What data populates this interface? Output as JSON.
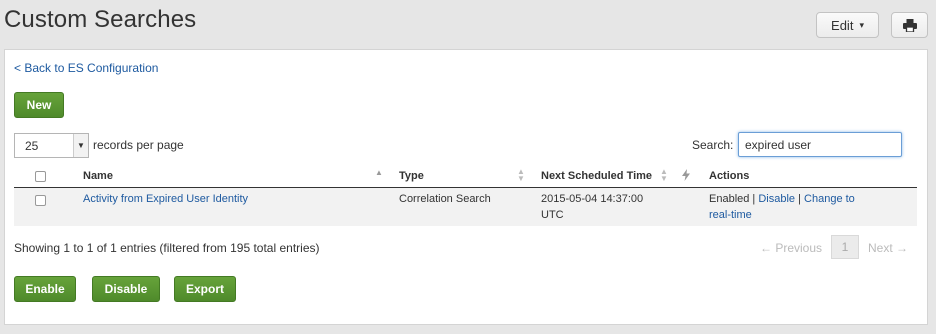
{
  "header": {
    "title": "Custom Searches",
    "edit_label": "Edit",
    "edit_caret": "▾"
  },
  "nav": {
    "back_label": "< Back to ES Configuration"
  },
  "toolbar": {
    "new_label": "New",
    "page_size": "25",
    "records_per_page_label": "records per page",
    "search_label": "Search:",
    "search_value": "expired user"
  },
  "table": {
    "columns": [
      "Name",
      "Type",
      "Next Scheduled Time",
      "Actions"
    ],
    "rows": [
      {
        "name": "Activity from Expired User Identity",
        "type": "Correlation Search",
        "next_time_line1": "2015-05-04 14:37:00",
        "next_time_line2": "UTC",
        "status": "Enabled",
        "sep1": " | ",
        "disable": "Disable",
        "sep2": " | ",
        "change_to_line1": "Change to",
        "change_to_line2": "real-time"
      }
    ]
  },
  "footer": {
    "info": "Showing 1 to 1 of 1 entries (filtered from 195 total entries)",
    "prev_label": "← Previous",
    "page_number": "1",
    "next_label": "Next →",
    "enable_label": "Enable",
    "disable_label": "Disable",
    "export_label": "Export"
  },
  "colors": {
    "accent_green": "#5a9632",
    "link_blue": "#1e5aa0"
  }
}
